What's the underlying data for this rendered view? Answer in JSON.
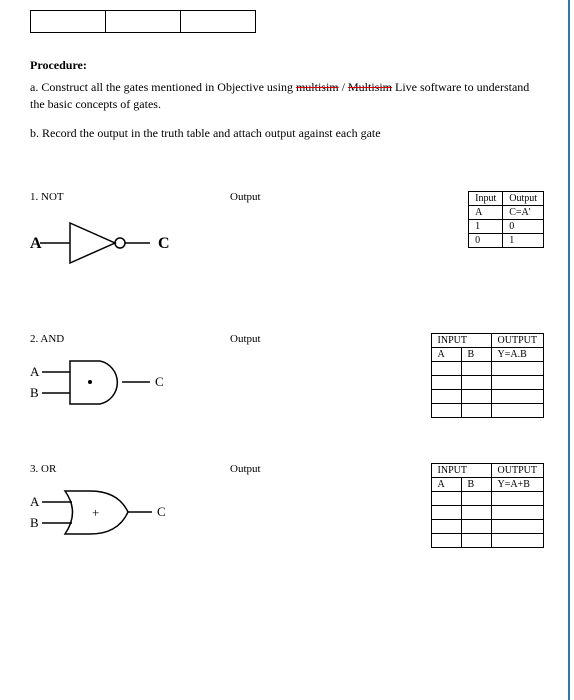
{
  "procedure": {
    "heading": "Procedure:",
    "item_a_prefix": "a. Construct all the gates mentioned in Objective using ",
    "item_a_strike1": "multisim",
    "item_a_slash": " / ",
    "item_a_strike2": "Multisim",
    "item_a_suffix": " Live software to understand the basic concepts of gates.",
    "item_b": "b. Record the output in the truth table and attach output against each gate"
  },
  "gates": {
    "not": {
      "label": "1. NOT",
      "output": "Output",
      "inA": "A",
      "outC": "C",
      "table": {
        "h1": "Input",
        "h2": "Output",
        "r1c1": "A",
        "r1c2": "C=A'",
        "r2c1": "1",
        "r2c2": "0",
        "r3c1": "0",
        "r3c2": "1"
      }
    },
    "and": {
      "label": "2. AND",
      "output": "Output",
      "inA": "A",
      "inB": "B",
      "outC": "C",
      "table": {
        "h1": "INPUT",
        "h2": "OUTPUT",
        "r1c1": "A",
        "r1c2": "B",
        "r1c3": "Y=A.B"
      }
    },
    "or": {
      "label": "3. OR",
      "output": "Output",
      "inA": "A",
      "inB": "B",
      "outC": "C",
      "table": {
        "h1": "INPUT",
        "h2": "OUTPUT",
        "r1c1": "A",
        "r1c2": "B",
        "r1c3": "Y=A+B"
      }
    }
  }
}
